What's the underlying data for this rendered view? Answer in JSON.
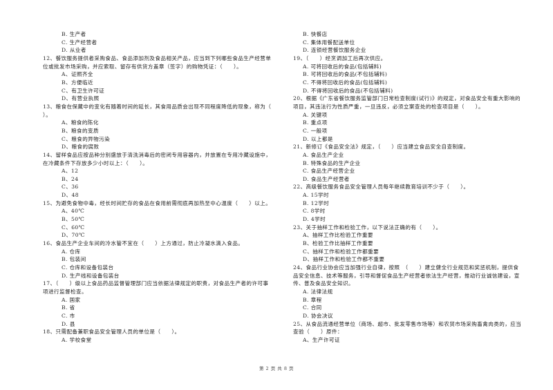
{
  "left_column": [
    {
      "type": "opt",
      "text": "B. 生产者"
    },
    {
      "type": "opt",
      "text": "C. 生产经营者"
    },
    {
      "type": "opt",
      "text": "D. 从业者"
    },
    {
      "type": "q",
      "text": "12、餐饮服务提供者采购食品、食品添加剂及食品相关产品，应当到下列哪些食品生产经营单"
    },
    {
      "type": "q",
      "text": "位或批发市场采购，并应索取、留存有供货方盖章（签字）的购物凭证：（　　）。"
    },
    {
      "type": "opt",
      "text": "A、证照齐全"
    },
    {
      "type": "opt",
      "text": "B、方便临近"
    },
    {
      "type": "opt",
      "text": "C、有卫生许可证"
    },
    {
      "type": "opt",
      "text": "D、有营业执照"
    },
    {
      "type": "q",
      "text": "13、粮食在保藏中的变化有随着时间的延长，其食用品质会出现不同程度降低的现象，称为（"
    },
    {
      "type": "q",
      "text": "）。"
    },
    {
      "type": "opt",
      "text": "A、粮食的陈化"
    },
    {
      "type": "opt",
      "text": "B、粮食的变质"
    },
    {
      "type": "opt",
      "text": "C、粮食的异物污染"
    },
    {
      "type": "opt",
      "text": "D、粮食的腐败"
    },
    {
      "type": "q",
      "text": "14、留样食品应按品种分别盛放于清洗消毒后的密闭专用容器内，并放置在专用冷藏设施中，"
    },
    {
      "type": "q",
      "text": "在冷藏条件下存放多少小时以上：（　　）。"
    },
    {
      "type": "opt",
      "text": "A、12"
    },
    {
      "type": "opt",
      "text": "B、24"
    },
    {
      "type": "opt",
      "text": "C、36"
    },
    {
      "type": "opt",
      "text": "D、48"
    },
    {
      "type": "q",
      "text": "15、为避免食物中毒，经长时间贮存的食品在食用前需彻底再加热至中心温度（　　）以上。"
    },
    {
      "type": "opt",
      "text": "A、40℃"
    },
    {
      "type": "opt",
      "text": "B、50℃"
    },
    {
      "type": "opt",
      "text": "C、60℃"
    },
    {
      "type": "opt",
      "text": "D、70℃"
    },
    {
      "type": "q",
      "text": "16、食品生产企业车间的冷水管不宜在（　　）上方通过，防止冷凝水滴入食品。"
    },
    {
      "type": "opt",
      "text": "A. 仓库"
    },
    {
      "type": "opt",
      "text": "B. 包装间"
    },
    {
      "type": "opt",
      "text": "C. 仓库和设备包装台"
    },
    {
      "type": "opt",
      "text": "D. 生产线和设备包装台"
    },
    {
      "type": "q",
      "text": "17、（　　）级以上食品药品监督管理部门应当依据法律规定的职责，对食品生产者的许可事"
    },
    {
      "type": "q",
      "text": "项进行监督检查。"
    },
    {
      "type": "opt",
      "text": "A. 国家"
    },
    {
      "type": "opt",
      "text": "B. 省"
    },
    {
      "type": "opt",
      "text": "C. 市"
    },
    {
      "type": "opt",
      "text": "D. 县"
    },
    {
      "type": "q",
      "text": "18、只需配备兼职食品安全管理人员的单位是（　　）。"
    },
    {
      "type": "opt",
      "text": "A. 学校食堂"
    }
  ],
  "right_column": [
    {
      "type": "opt",
      "text": "B. 快餐店"
    },
    {
      "type": "opt",
      "text": "C. 集体用餐配送单位"
    },
    {
      "type": "opt",
      "text": "D. 连锁经营餐饮服务企业"
    },
    {
      "type": "q",
      "text": "19、（　　）经烹调加工后再次供应。"
    },
    {
      "type": "opt",
      "text": "A. 可将回收后的食品(包括辅料)"
    },
    {
      "type": "opt",
      "text": "B. 可将回收后的食品(不包括辅料)"
    },
    {
      "type": "opt",
      "text": "C. 不得将回收后的食品(包括辅料)"
    },
    {
      "type": "opt",
      "text": "D. 不得将回收后的食品(不包括辅料)"
    },
    {
      "type": "q",
      "text": "20、根据《广东省餐饮服务监管部门日常检查制度(试行)》的规定，对食品安全有重大影响的"
    },
    {
      "type": "q",
      "text": "项目，其违法行为性质严重，一旦违反，必须立案查处的检查项目是（　　）。"
    },
    {
      "type": "opt",
      "text": "A. 关键项"
    },
    {
      "type": "opt",
      "text": "B. 重点项"
    },
    {
      "type": "opt",
      "text": "C. 一般项"
    },
    {
      "type": "opt",
      "text": "D. 以上都是"
    },
    {
      "type": "q",
      "text": "21、新修订《食品安全法》规定，（　　）应当建立食品安全自查制度。"
    },
    {
      "type": "opt",
      "text": "A. 食品生产企业"
    },
    {
      "type": "opt",
      "text": "B. 特殊食品的生产企业"
    },
    {
      "type": "opt",
      "text": "C. 食品生产经营企业"
    },
    {
      "type": "opt",
      "text": "D. 食品生产经营者"
    },
    {
      "type": "q",
      "text": "22、高级餐饮服务食品安全管理人员每年继续教育培训不少于（　　）。"
    },
    {
      "type": "opt",
      "text": "A. 15学时"
    },
    {
      "type": "opt",
      "text": "B. 12学时"
    },
    {
      "type": "opt",
      "text": "C. 8学时"
    },
    {
      "type": "opt",
      "text": "D. 4学时"
    },
    {
      "type": "q",
      "text": "23、关于抽样工作和检验工作，以下说法正确的有（　　）。"
    },
    {
      "type": "opt",
      "text": "A、抽样工作比检验工作重要"
    },
    {
      "type": "opt",
      "text": "B、检验工作比抽样工作重要"
    },
    {
      "type": "opt",
      "text": "C、抽样工作和检验工作都重要"
    },
    {
      "type": "opt",
      "text": "D、抽样工作和检验工作都不重要"
    },
    {
      "type": "q",
      "text": "24、食品行业协会应当加强行业自律，按照　（　　）建立健全行业规范和奖惩机制，提供食"
    },
    {
      "type": "q",
      "text": "品安全信息、技术等服务，引导和督促食品生产经营者依法生产经营，推动行业诚信建设，宣"
    },
    {
      "type": "q",
      "text": "传、普及食品安全知识。"
    },
    {
      "type": "opt",
      "text": "A. 法律法规"
    },
    {
      "type": "opt",
      "text": "B. 章程"
    },
    {
      "type": "opt",
      "text": "C. 合同"
    },
    {
      "type": "opt",
      "text": "D. 协会决议"
    },
    {
      "type": "q",
      "text": "25、从食品流通经营单位（商场、超市、批发零售市场等）和农贸市场采购畜禽肉类的，应当"
    },
    {
      "type": "q",
      "text": "查验（　　）原件："
    },
    {
      "type": "opt",
      "text": "A、生产许可证"
    }
  ],
  "footer": {
    "page_info": "第 2 页 共 8 页"
  }
}
